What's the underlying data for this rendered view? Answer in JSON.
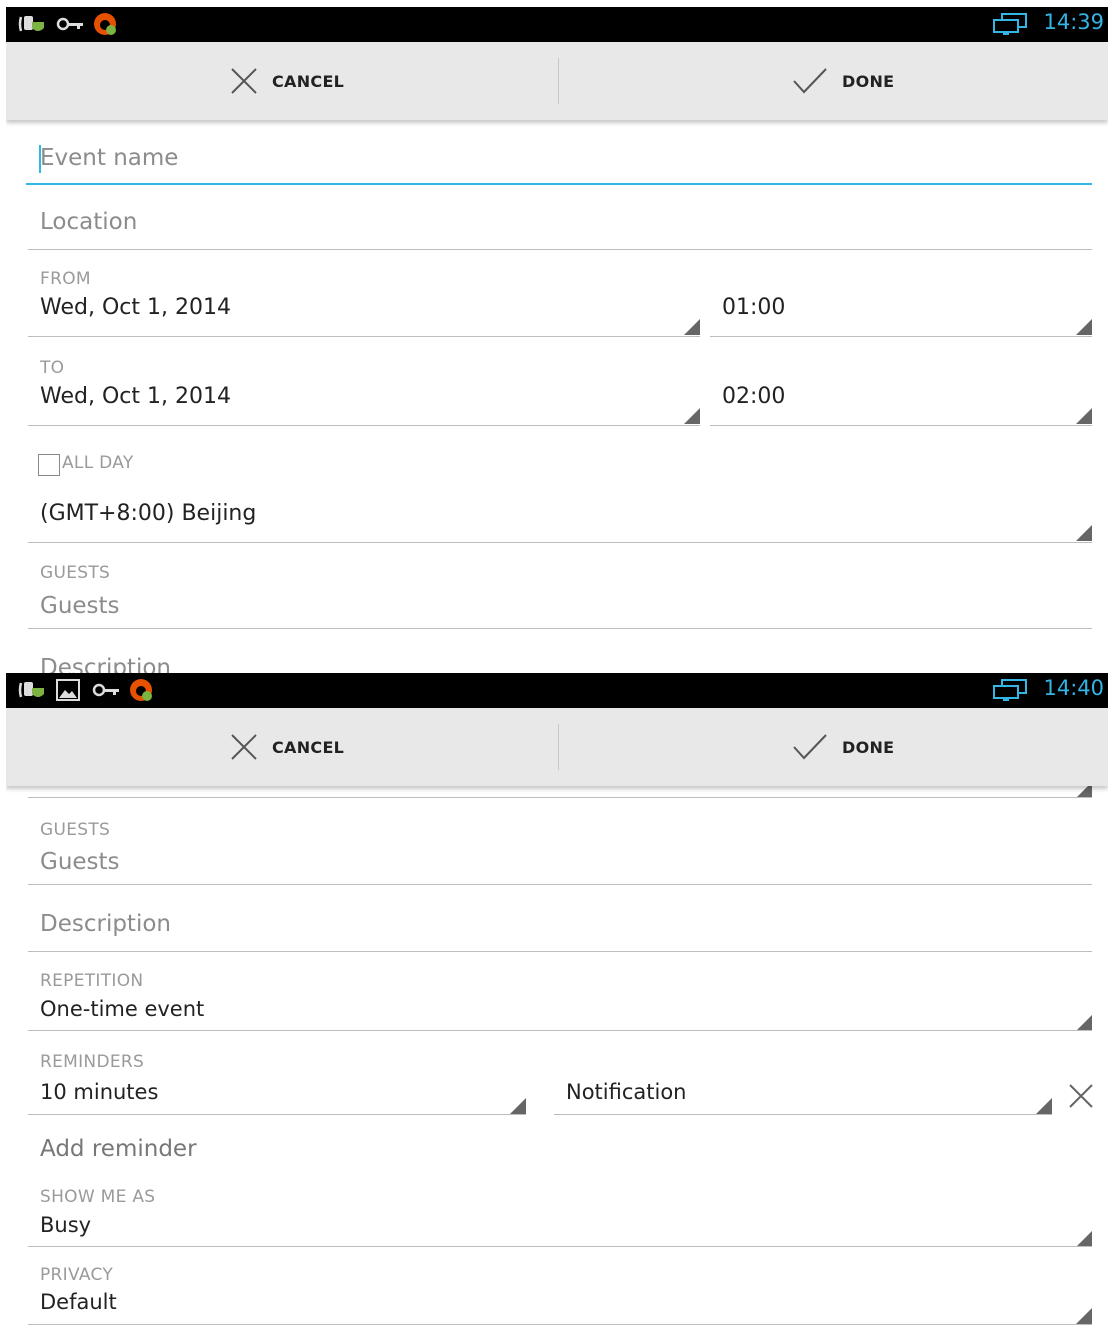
{
  "screen1": {
    "status": {
      "time": "14:39"
    },
    "actionbar": {
      "cancel_label": "CANCEL",
      "done_label": "DONE"
    },
    "event_name": {
      "placeholder": "Event name"
    },
    "location": {
      "placeholder": "Location"
    },
    "from": {
      "label": "FROM",
      "date": "Wed, Oct 1, 2014",
      "time": "01:00"
    },
    "to": {
      "label": "TO",
      "date": "Wed, Oct 1, 2014",
      "time": "02:00"
    },
    "all_day": {
      "label": "ALL DAY",
      "checked": false
    },
    "timezone": {
      "value": "(GMT+8:00) Beijing"
    },
    "guests": {
      "label": "GUESTS",
      "placeholder": "Guests"
    },
    "description": {
      "placeholder": "Description"
    }
  },
  "screen2": {
    "status": {
      "time": "14:40"
    },
    "actionbar": {
      "cancel_label": "CANCEL",
      "done_label": "DONE"
    },
    "guests": {
      "label": "GUESTS",
      "placeholder": "Guests"
    },
    "description": {
      "placeholder": "Description"
    },
    "repetition": {
      "label": "REPETITION",
      "value": "One-time event"
    },
    "reminders": {
      "label": "REMINDERS",
      "time": "10 minutes",
      "method": "Notification"
    },
    "add_reminder": {
      "label": "Add reminder"
    },
    "show_me_as": {
      "label": "SHOW ME AS",
      "value": "Busy"
    },
    "privacy": {
      "label": "PRIVACY",
      "value": "Default"
    }
  },
  "colors": {
    "accent": "#33b5e5",
    "actionbar": "#e8e8e8",
    "statusbar": "#000000",
    "hint": "#8c8c8c"
  },
  "icons": [
    "phone-shield-icon",
    "key-icon",
    "sync-app-icon",
    "image-icon",
    "screen-cast-icon",
    "close-icon",
    "check-icon",
    "remove-reminder-icon"
  ]
}
